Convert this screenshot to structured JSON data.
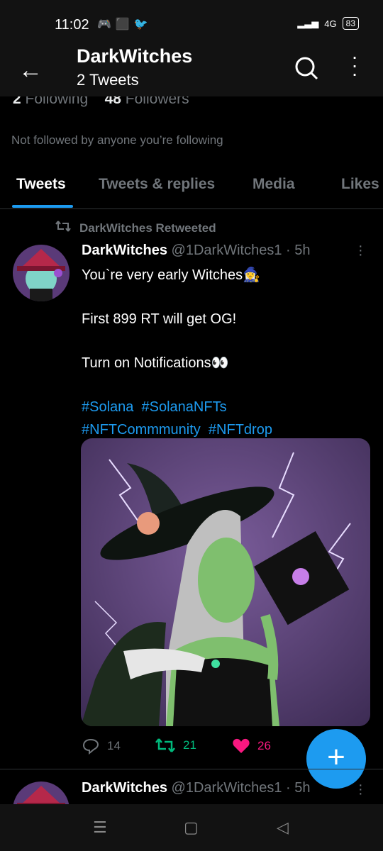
{
  "status": {
    "time": "11:02",
    "network": "4G",
    "battery": "83"
  },
  "header": {
    "title": "DarkWitches",
    "subtitle": "2 Tweets"
  },
  "profile": {
    "following_count": "2",
    "following_label": "Following",
    "followers_count": "48",
    "followers_label": "Followers",
    "not_followed": "Not followed by anyone you’re following"
  },
  "tabs": [
    {
      "label": "Tweets"
    },
    {
      "label": "Tweets & replies"
    },
    {
      "label": "Media"
    },
    {
      "label": "Likes"
    }
  ],
  "tweet": {
    "retweeted_by": "DarkWitches Retweeted",
    "author_name": "DarkWitches",
    "author_handle": "@1DarkWitches1 · 5h",
    "line1": "You`re very early Witches🧙‍♀️",
    "line2": "First 899 RT will get OG!",
    "line3": "Turn on Notifications👀",
    "hashtags_line1": "#Solana  #SolanaNFTs",
    "hashtags_line2": "#NFTCommmunity  #NFTdrop",
    "replies": "14",
    "retweets": "21",
    "likes": "26"
  },
  "tweet2": {
    "author_name": "DarkWitches",
    "author_handle": "@1DarkWitches1 · 5h"
  },
  "colors": {
    "accent": "#1d9bf0",
    "retweet": "#00ba7c",
    "like": "#f91880",
    "muted": "#71767b"
  }
}
